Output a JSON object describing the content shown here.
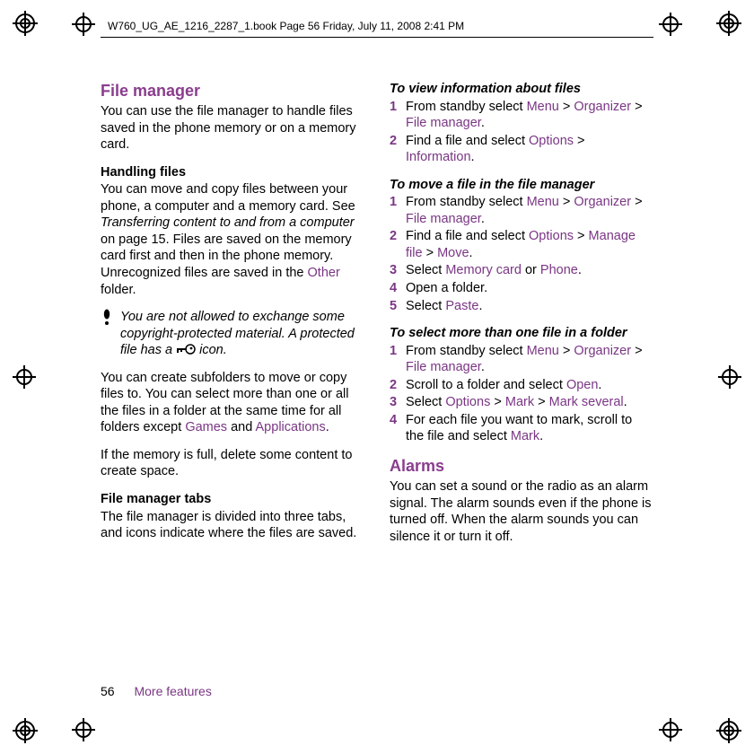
{
  "header": "W760_UG_AE_1216_2287_1.book  Page 56  Friday, July 11, 2008  2:41 PM",
  "footer": {
    "page": "56",
    "section": "More features"
  },
  "left": {
    "h_filemgr": "File manager",
    "p1": "You can use the file manager to handle files saved in the phone memory or on a memory card.",
    "h_handling": "Handling files",
    "p2a": "You can move and copy files between your phone, a computer and a memory card. See ",
    "p2i": "Transferring content to and from a computer",
    "p2b": " on page 15. Files are saved on the memory card first and then in the phone memory. Unrecognized files are saved in the ",
    "p2ui": "Other",
    "p2c": " folder.",
    "note_a": "You are not allowed to exchange some copyright-protected material. A protected file has a ",
    "note_b": " icon.",
    "p3a": "You can create subfolders to move or copy files to. You can select more than one or all the files in a folder at the same time for all folders except ",
    "p3ui1": "Games",
    "p3mid": " and ",
    "p3ui2": "Applications",
    "p3c": ".",
    "p4": "If the memory is full, delete some content to create space.",
    "h_tabs": "File manager tabs",
    "p5": "The file manager is divided into three tabs, and icons indicate where the files are saved."
  },
  "right": {
    "h_view": "To view information about files",
    "s_view": [
      {
        "num": "1",
        "a": "From standby select ",
        "parts": [
          "Menu",
          " > ",
          "Organizer",
          " > ",
          "File manager",
          "."
        ]
      },
      {
        "num": "2",
        "a": "Find a file and select ",
        "parts": [
          "Options",
          " > ",
          "Information",
          "."
        ]
      }
    ],
    "h_move": "To move a file in the file manager",
    "s_move": [
      {
        "num": "1",
        "a": "From standby select ",
        "parts": [
          "Menu",
          " > ",
          "Organizer",
          " > ",
          "File manager",
          "."
        ]
      },
      {
        "num": "2",
        "a": "Find a file and select ",
        "parts": [
          "Options",
          " > ",
          "Manage file",
          " > ",
          "Move",
          "."
        ]
      },
      {
        "num": "3",
        "a": "Select ",
        "parts": [
          "Memory card",
          " or ",
          "Phone",
          "."
        ]
      },
      {
        "num": "4",
        "plain": "Open a folder."
      },
      {
        "num": "5",
        "a": "Select ",
        "parts": [
          "Paste",
          "."
        ]
      }
    ],
    "h_select": "To select more than one file in a folder",
    "s_select": [
      {
        "num": "1",
        "a": "From standby select ",
        "parts": [
          "Menu",
          " > ",
          "Organizer",
          " > ",
          "File manager",
          "."
        ]
      },
      {
        "num": "2",
        "a": "Scroll to a folder and select ",
        "parts": [
          "Open",
          "."
        ]
      },
      {
        "num": "3",
        "a": "Select ",
        "parts": [
          "Options",
          " > ",
          "Mark",
          " > ",
          "Mark several",
          "."
        ]
      },
      {
        "num": "4",
        "a": "For each file you want to mark, scroll to the file and select ",
        "parts": [
          "Mark",
          "."
        ]
      }
    ],
    "h_alarms": "Alarms",
    "p_alarms": "You can set a sound or the radio as an alarm signal. The alarm sounds even if the phone is turned off. When the alarm sounds you can silence it or turn it off."
  }
}
